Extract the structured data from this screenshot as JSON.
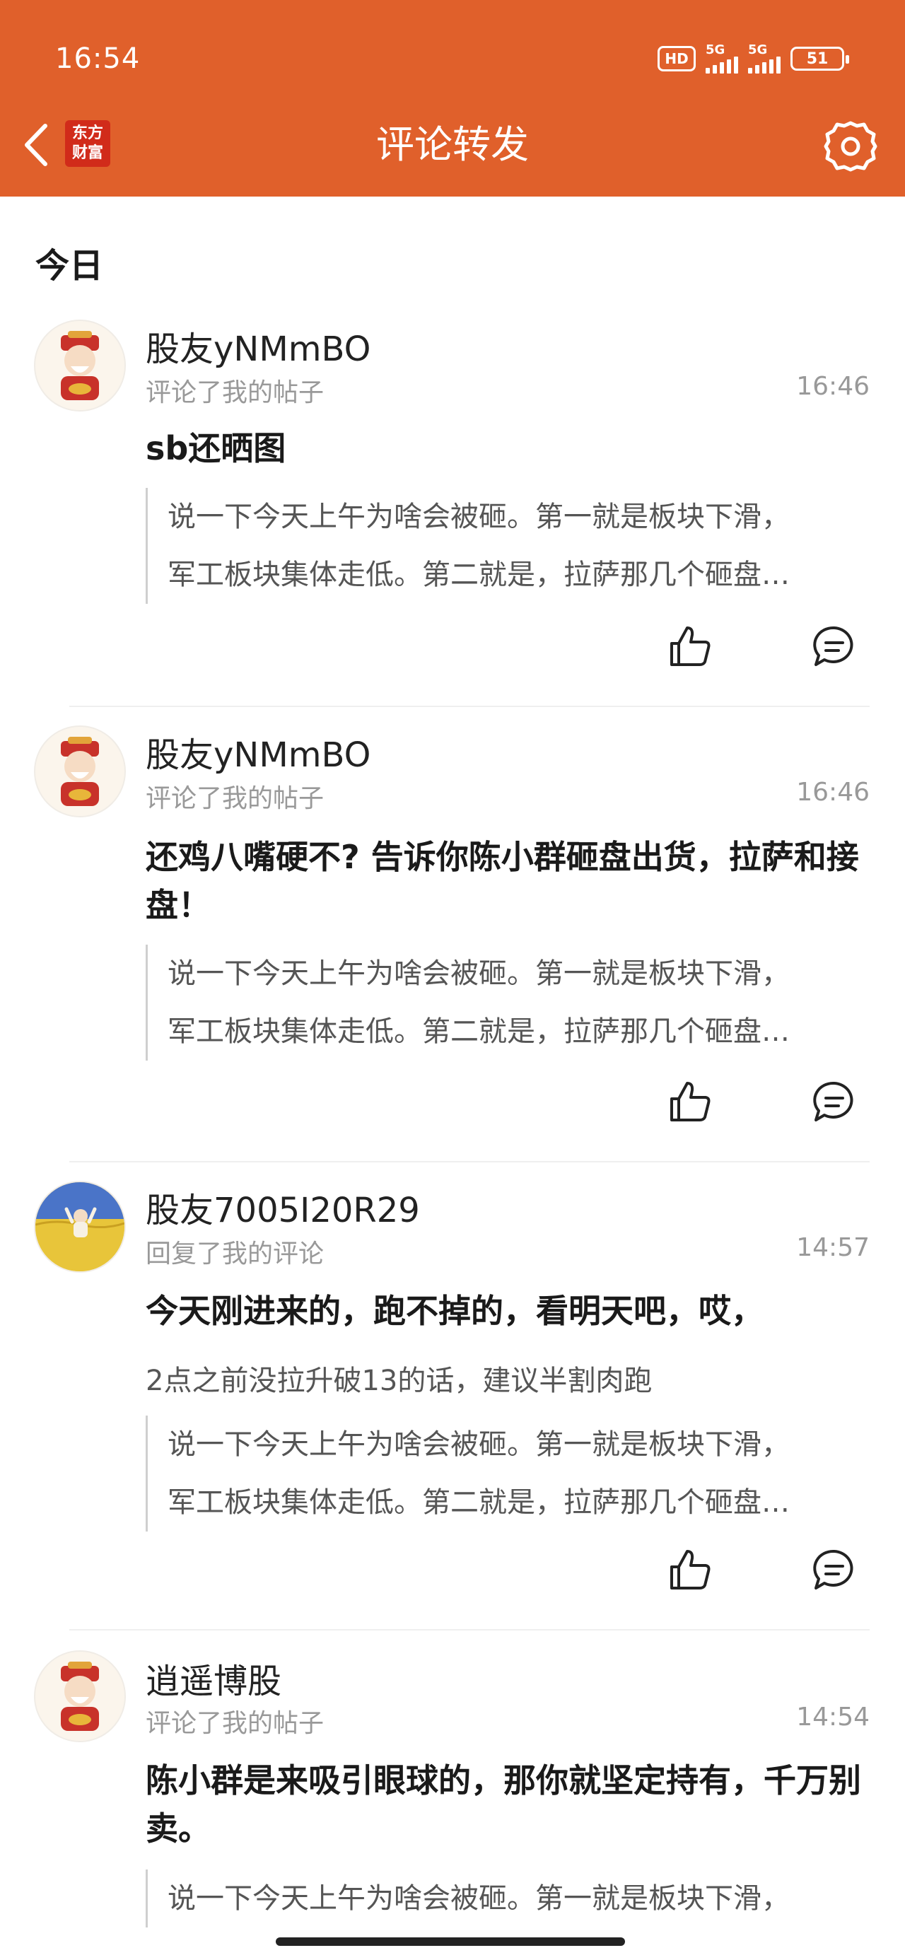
{
  "status_bar": {
    "time": "16:54",
    "hd": "HD",
    "net1": "5G",
    "net2": "5G",
    "battery": "51"
  },
  "header": {
    "title": "评论转发",
    "logo_line1": "东方",
    "logo_line2": "财富"
  },
  "section": {
    "label": "今日"
  },
  "items": [
    {
      "user": "股友yNMmBO",
      "action": "评论了我的帖子",
      "time": "16:46",
      "comment": "sb还晒图",
      "quote1": "说一下今天上午为啥会被砸。第一就是板块下滑，",
      "quote2": "军工板块集体走低。第二就是，拉萨那几个砸盘…"
    },
    {
      "user": "股友yNMmBO",
      "action": "评论了我的帖子",
      "time": "16:46",
      "comment": "还鸡八嘴硬不? 告诉你陈小群砸盘出货，拉萨和接盘！",
      "quote1": "说一下今天上午为啥会被砸。第一就是板块下滑，",
      "quote2": "军工板块集体走低。第二就是，拉萨那几个砸盘…"
    },
    {
      "user": "股友7005I20R29",
      "action": "回复了我的评论",
      "time": "14:57",
      "comment": "今天刚进来的，跑不掉的，看明天吧，哎，",
      "subtext": "2点之前没拉升破13的话，建议半割肉跑",
      "quote1": "说一下今天上午为啥会被砸。第一就是板块下滑，",
      "quote2": "军工板块集体走低。第二就是，拉萨那几个砸盘…"
    },
    {
      "user": "逍遥博股",
      "action": "评论了我的帖子",
      "time": "14:54",
      "comment": "陈小群是来吸引眼球的，那你就坚定持有，千万别卖。",
      "quote1": "说一下今天上午为啥会被砸。第一就是板块下滑，"
    }
  ],
  "colors": {
    "header_bg": "#e0602b",
    "logo_bg": "#d12b1a"
  }
}
